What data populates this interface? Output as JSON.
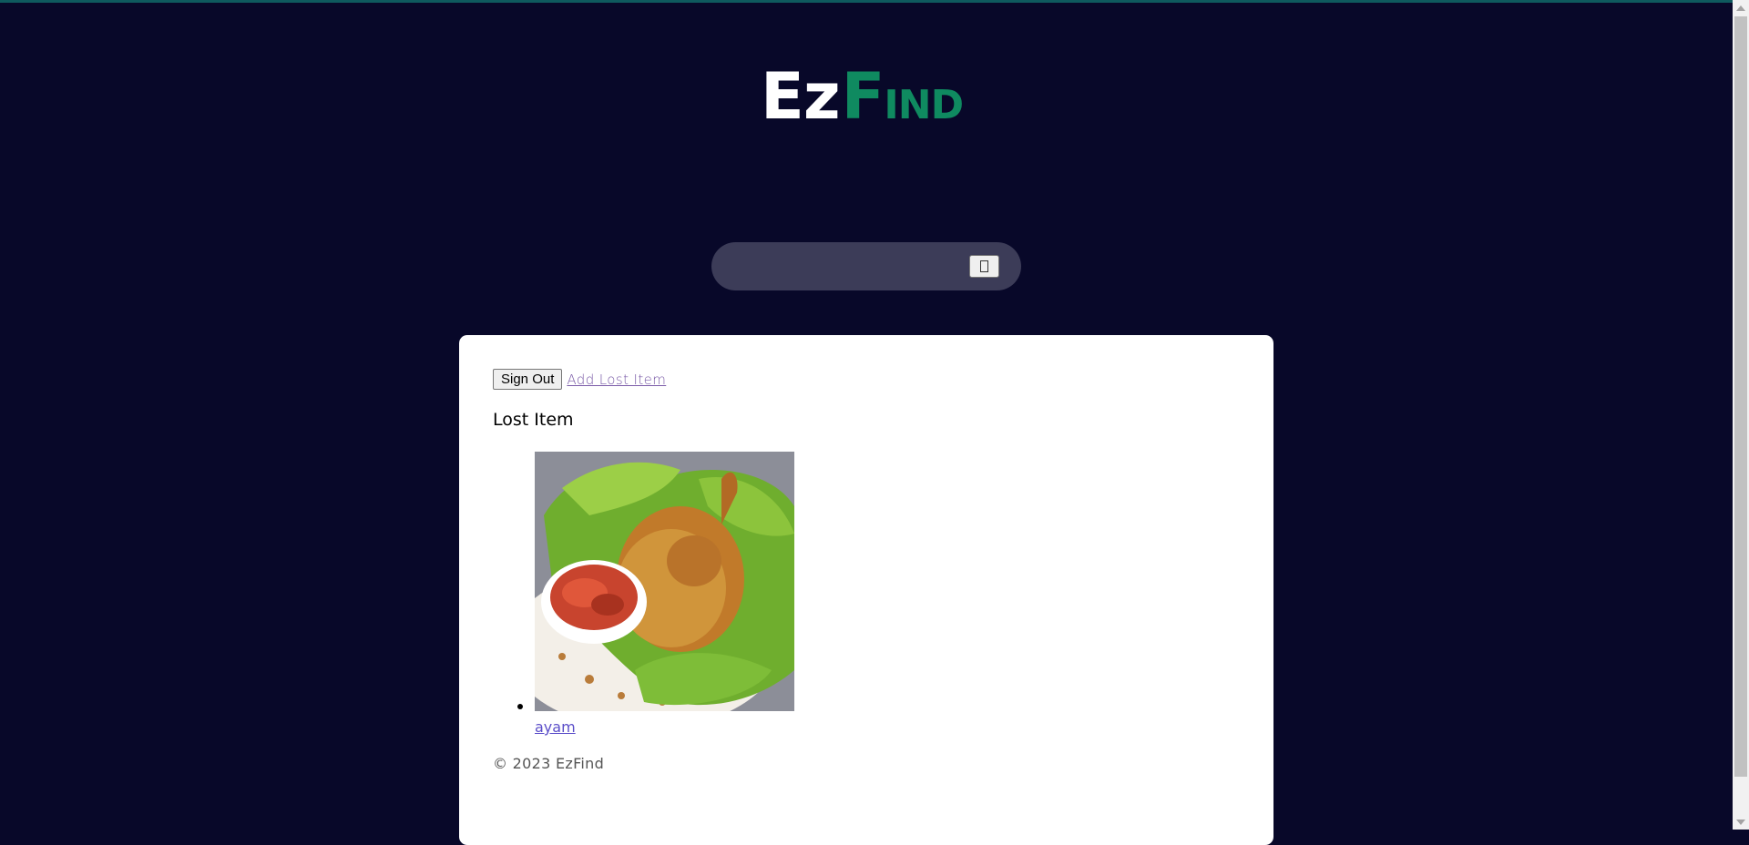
{
  "brand": {
    "logo_part1": "Ez",
    "logo_part2": "F",
    "logo_part3": "IND",
    "colors": {
      "ez": "#ffffff",
      "find": "#0f8a60",
      "background": "#080829"
    }
  },
  "search": {
    "value": "",
    "placeholder": "",
    "button_icon": "search-icon"
  },
  "actions": {
    "sign_out_label": "Sign Out",
    "add_lost_item_label": "Add Lost Item"
  },
  "section": {
    "title": "Lost Item"
  },
  "items": [
    {
      "name": "ayam",
      "image": "fried-chicken-with-sambal-photo"
    }
  ],
  "footer": {
    "copyright": "© 2023 EzFind"
  }
}
